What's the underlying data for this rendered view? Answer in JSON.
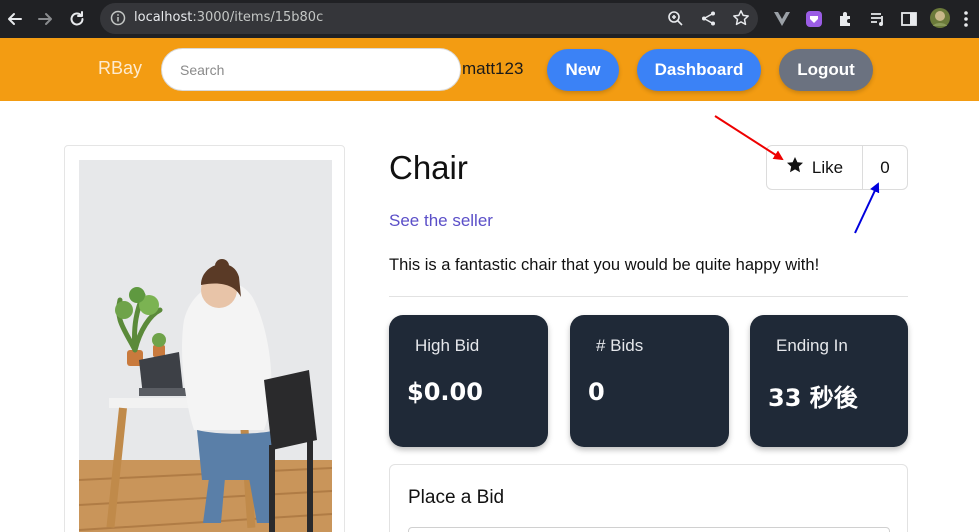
{
  "browser": {
    "url_host": "localhost",
    "url_path": ":3000/items/15b80c",
    "icons": [
      "back-icon",
      "forward-icon",
      "reload-icon",
      "info-icon",
      "zoom-icon",
      "share-icon",
      "bookmark-star-icon",
      "vue-extension-icon",
      "purple-extension-icon",
      "extensions-puzzle-icon",
      "media-control-icon",
      "side-panel-icon",
      "profile-avatar-icon",
      "menu-dots-icon"
    ]
  },
  "navbar": {
    "brand": "RBay",
    "search_placeholder": "Search",
    "username": "matt123",
    "new_label": "New",
    "dashboard_label": "Dashboard",
    "logout_label": "Logout",
    "colors": {
      "bar": "#f39c12",
      "primary": "#3b82f6",
      "secondary": "#6b7280"
    }
  },
  "item": {
    "title": "Chair",
    "like_label": "Like",
    "like_count": "0",
    "seller_link": "See the seller",
    "description": "This is a fantastic chair that you would be quite happy with!",
    "stats": [
      {
        "label": "High Bid",
        "value": "$0.00"
      },
      {
        "label": "# Bids",
        "value": "0"
      },
      {
        "label": "Ending In",
        "value": "33 秒後"
      }
    ],
    "bid_title": "Place a Bid",
    "image_description": "woman-at-desk-photo"
  },
  "annotations": {
    "red_arrow_color": "#ee0000",
    "blue_arrow_color": "#0000dd"
  }
}
